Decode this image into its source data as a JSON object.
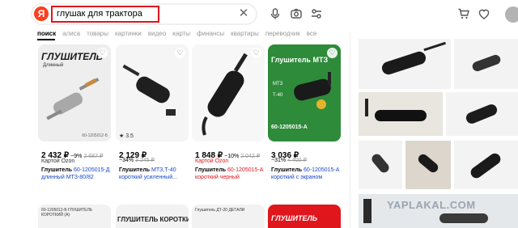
{
  "search": {
    "logo": "Я",
    "query": "глушак для трактора"
  },
  "tabs": [
    "поиск",
    "алиса",
    "товары",
    "картинки",
    "видео",
    "карты",
    "финансы",
    "квартиры",
    "переводчик",
    "все"
  ],
  "products": [
    {
      "image_label_top": "ГЛУШИТЕЛЬ",
      "image_label_sub": "Длинный",
      "image_code": "60-1205012-Б",
      "price": "2 432 ₽",
      "discount": "−9%",
      "old_price": "2 687 ₽",
      "seller": "Картой Ozon",
      "title_bold": "Глушитель",
      "title_blue": "60-1205015-Д длинный МТЗ-80/82",
      "rating": ""
    },
    {
      "image_label_top": "",
      "image_label_sub": "",
      "image_code": "",
      "price": "2 129 ₽",
      "discount": "−34%",
      "old_price": "3 245 ₽",
      "seller": "",
      "title_bold": "Глушитель",
      "title_blue": "МТЗ,Т-40 короткий усиленный...",
      "rating": "★ 3.5"
    },
    {
      "image_label_top": "",
      "image_label_sub": "",
      "image_code": "",
      "price": "1 848 ₽",
      "discount": "−10%",
      "old_price": "2 042 ₽",
      "seller": "Картой Ozon",
      "title_bold": "Глушитель",
      "title_blue": "60-1205015-А короткий черный",
      "rating": ""
    },
    {
      "image_label_top": "Глушитель МТЗ",
      "image_label_sub": "МТЗ Т-40",
      "image_code": "60-1205015-А",
      "price": "3 036 ₽",
      "discount": "−31%",
      "old_price": "4 400 ₽",
      "seller": "Картой Ozon",
      "title_bold": "Глушитель",
      "title_blue": "60-1205015-А короткий с экраном",
      "rating": ""
    }
  ],
  "row2_labels": [
    "60-1205012-Б ГЛУШИТЕЛЬ КОРОТКИЙ (А)",
    "ГЛУШИТЕЛЬ КОРОТКИЙ",
    "Глушитель ДТ-20 ДЕТАЛИ",
    "ГЛУШИТЕЛЬ"
  ],
  "watermark": "YAPLAKAL.COM",
  "colors": {
    "accent_red": "#e0161d",
    "link_blue": "#1a47c8",
    "ya_logo": "#fc3f1d"
  },
  "icons": [
    "clear-icon",
    "microphone-icon",
    "camera-search-icon",
    "filter-icon",
    "cart-icon",
    "heart-icon",
    "avatar"
  ]
}
